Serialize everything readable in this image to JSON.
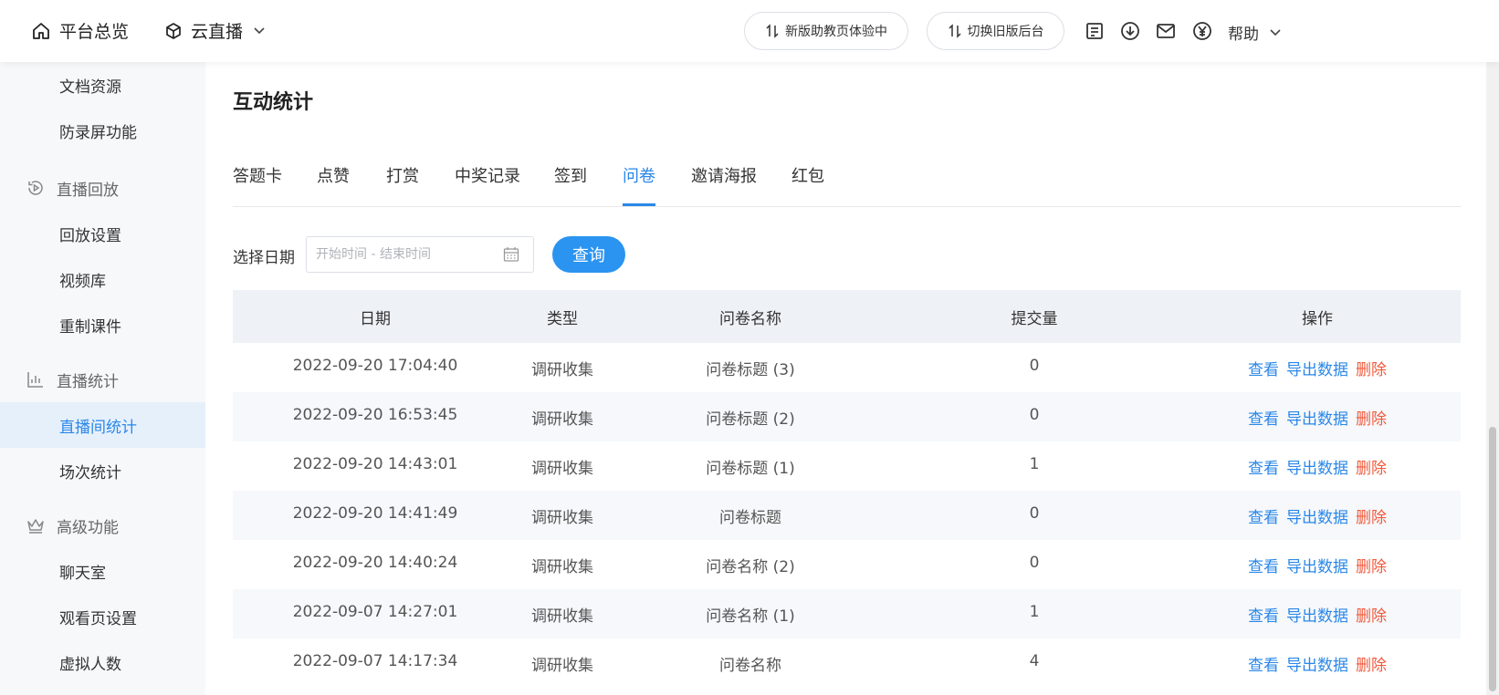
{
  "header": {
    "home_label": "平台总览",
    "live_label": "云直播",
    "new_pill_label": "新版助教页体验中",
    "old_pill_label": "切换旧版后台",
    "help_label": "帮助",
    "icons": [
      "home-icon",
      "cube-icon",
      "doc-icon",
      "download-icon",
      "mail-icon",
      "yen-icon"
    ]
  },
  "sidebar": {
    "items": [
      {
        "label": "文档资源",
        "kind": "sub"
      },
      {
        "label": "防录屏功能",
        "kind": "sub"
      },
      {
        "label": "直播回放",
        "kind": "group",
        "icon": "replay-icon"
      },
      {
        "label": "回放设置",
        "kind": "sub"
      },
      {
        "label": "视频库",
        "kind": "sub"
      },
      {
        "label": "重制课件",
        "kind": "sub"
      },
      {
        "label": "直播统计",
        "kind": "group",
        "icon": "stats-icon"
      },
      {
        "label": "直播间统计",
        "kind": "sub",
        "active": true
      },
      {
        "label": "场次统计",
        "kind": "sub"
      },
      {
        "label": "高级功能",
        "kind": "group",
        "icon": "crown-icon"
      },
      {
        "label": "聊天室",
        "kind": "sub"
      },
      {
        "label": "观看页设置",
        "kind": "sub"
      },
      {
        "label": "虚拟人数",
        "kind": "sub"
      }
    ]
  },
  "main": {
    "title": "互动统计",
    "tabs": [
      "答题卡",
      "点赞",
      "打赏",
      "中奖记录",
      "签到",
      "问卷",
      "邀请海报",
      "红包"
    ],
    "active_tab": "问卷",
    "filter": {
      "label": "选择日期",
      "placeholder": "开始时间 - 结束时间",
      "query_label": "查询"
    },
    "table": {
      "headers": [
        "日期",
        "类型",
        "问卷名称",
        "提交量",
        "操作"
      ],
      "actions": {
        "view": "查看",
        "export": "导出数据",
        "delete": "删除"
      },
      "rows": [
        {
          "date": "2022-09-20 17:04:40",
          "type": "调研收集",
          "name": "问卷标题 (3)",
          "count": "0"
        },
        {
          "date": "2022-09-20 16:53:45",
          "type": "调研收集",
          "name": "问卷标题 (2)",
          "count": "0"
        },
        {
          "date": "2022-09-20 14:43:01",
          "type": "调研收集",
          "name": "问卷标题 (1)",
          "count": "1"
        },
        {
          "date": "2022-09-20 14:41:49",
          "type": "调研收集",
          "name": "问卷标题",
          "count": "0"
        },
        {
          "date": "2022-09-20 14:40:24",
          "type": "调研收集",
          "name": "问卷名称 (2)",
          "count": "0"
        },
        {
          "date": "2022-09-07 14:27:01",
          "type": "调研收集",
          "name": "问卷名称 (1)",
          "count": "1"
        },
        {
          "date": "2022-09-07 14:17:34",
          "type": "调研收集",
          "name": "问卷名称",
          "count": "4"
        }
      ]
    }
  },
  "colors": {
    "accent": "#2a87e8",
    "button": "#2a94f0",
    "danger": "#f05a3c",
    "sidebar_bg": "#f7f8fa",
    "table_head_bg": "#eef1f6"
  }
}
